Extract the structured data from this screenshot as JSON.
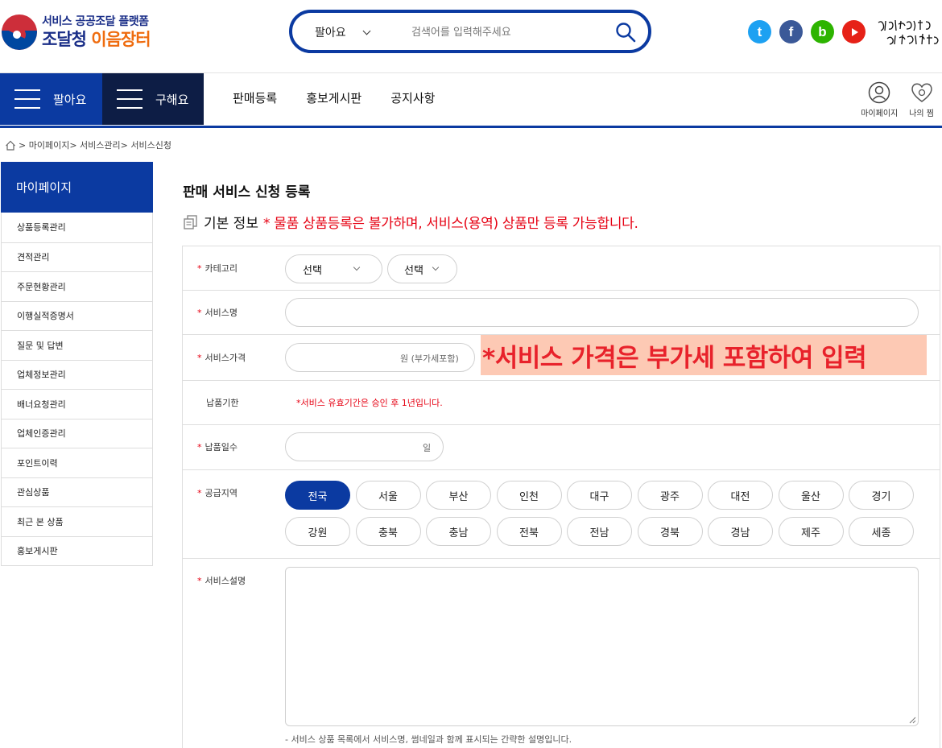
{
  "logo": {
    "sub": "서비스 공공조달 플랫폼",
    "main_prefix": "조달청 ",
    "main_accent": "이음장터",
    "emblem_icon": "taegeuk-emblem-icon"
  },
  "search": {
    "category": "팔아요",
    "placeholder": "검색어를 입력해주세요",
    "icon": "search-icon"
  },
  "social": {
    "twitter_glyph": "t",
    "facebook_glyph": "f",
    "blog_glyph": "b",
    "youtube_icon": "play-icon"
  },
  "colors": {
    "primary": "#0b3aa1",
    "dark_navy": "#0d1d45",
    "required": "#e60012",
    "accent_orange": "#ef6c0f",
    "highlight_bg": "#fdc9b4"
  },
  "gnb": {
    "sell_label": "팔아요",
    "buy_label": "구해요",
    "menu": [
      "판매등록",
      "홍보게시판",
      "공지사항"
    ],
    "mypage_label": "마이페이지",
    "wishlist_label": "나의 찜"
  },
  "breadcrumb": {
    "text": "> 마이페이지> 서비스관리> 서비스신청"
  },
  "sidebar": {
    "title": "마이페이지",
    "items": [
      "상품등록관리",
      "견적관리",
      "주문현황관리",
      "이행실적증명서",
      "질문 및 답변",
      "업체정보관리",
      "배너요청관리",
      "업체인증관리",
      "포인트이력",
      "관심상품",
      "최근 본 상품",
      "홍보게시판"
    ]
  },
  "main": {
    "title": "판매 서비스 신청 등록",
    "section_label": "기본 정보",
    "section_notice": "* 물품 상품등록은 불가하며, 서비스(용역) 상품만 등록 가능합니다."
  },
  "form": {
    "required_mark": "*",
    "category": {
      "label": "카테고리",
      "select1": "선택",
      "select2": "선택"
    },
    "service_name": {
      "label": "서비스명",
      "value": ""
    },
    "service_price": {
      "label": "서비스가격",
      "suffix": "원 (부가세포함)",
      "highlight": "*서비스 가격은 부가세 포함하여 입력"
    },
    "delivery_period": {
      "label": "납품기한",
      "notice": "*서비스 유효기간은 승인 후 1년입니다."
    },
    "delivery_days": {
      "label": "납품일수",
      "suffix": "일"
    },
    "supply_region": {
      "label": "공급지역",
      "selected": "전국",
      "regions": [
        "전국",
        "서울",
        "부산",
        "인천",
        "대구",
        "광주",
        "대전",
        "울산",
        "경기",
        "강원",
        "충북",
        "충남",
        "전북",
        "전남",
        "경북",
        "경남",
        "제주",
        "세종"
      ]
    },
    "service_desc": {
      "label": "서비스설명",
      "help": "- 서비스 상품 목록에서 서비스명, 썸네일과 함께 표시되는 간략한 설명입니다."
    }
  }
}
